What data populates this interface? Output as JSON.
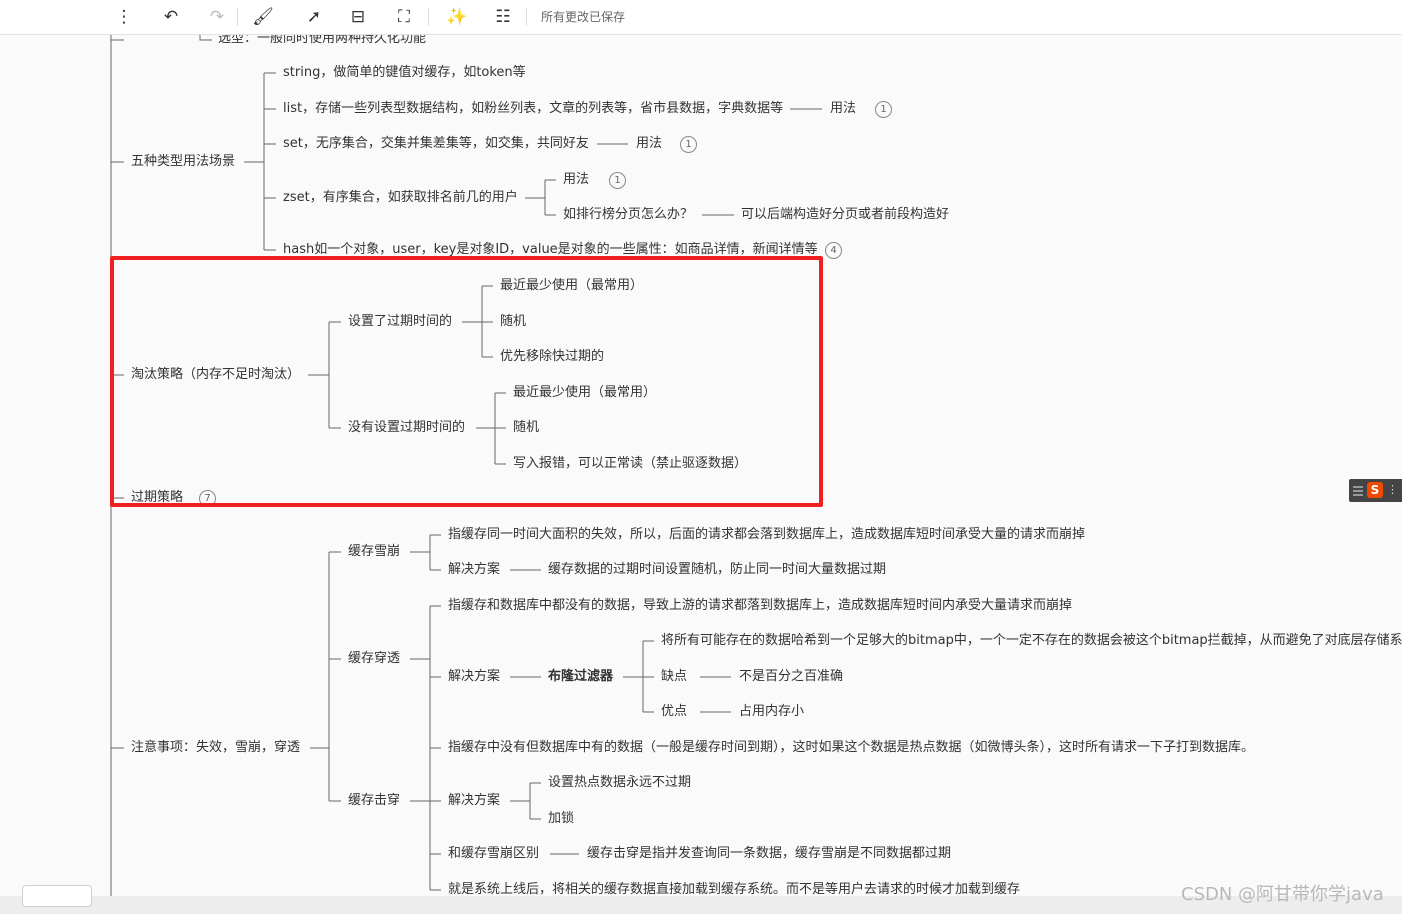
{
  "toolbar": {
    "save_status": "所有更改已保存",
    "buttons": [
      {
        "name": "more-options-icon",
        "glyph": "⋮"
      },
      {
        "name": "undo-icon",
        "glyph": "↶"
      },
      {
        "name": "redo-icon",
        "glyph": "↷"
      },
      {
        "name": "format-painter-icon",
        "glyph": "🖌"
      },
      {
        "name": "arrow-connect-icon",
        "glyph": "➚"
      },
      {
        "name": "insert-child-icon",
        "glyph": "⊟"
      },
      {
        "name": "frame-icon",
        "glyph": "⛶"
      },
      {
        "name": "magic-style-icon",
        "glyph": "✨"
      },
      {
        "name": "outline-structure-icon",
        "glyph": "☷"
      }
    ]
  },
  "nodes": {
    "top_partial": "选型：一般同时使用两种持久化功能",
    "five_types": "五种类型用法场景",
    "string": "string，做简单的键值对缓存，如token等",
    "list": "list，存储一些列表型数据结构，如粉丝列表，文章的列表等，省市县数据，字典数据等",
    "list_usage": "用法",
    "list_badge": "1",
    "set": "set，无序集合，交集并集差集等，如交集，共同好友",
    "set_usage": "用法",
    "set_badge": "1",
    "zset": "zset，有序集合，如获取排名前几的用户",
    "zset_usage": "用法",
    "zset_badge": "1",
    "zset_paging_q": "如排行榜分页怎么办？",
    "zset_paging_a": "可以后端构造好分页或者前段构造好",
    "hash": "hash如一个对象，user，key是对象ID，value是对象的一些属性：如商品详情，新闻详情等",
    "hash_badge": "4",
    "eviction": "淘汰策略（内存不足时淘汰）",
    "with_expire": "设置了过期时间的",
    "we_lru": "最近最少使用（最常用）",
    "we_random": "随机",
    "we_ttl": "优先移除快过期的",
    "no_expire": "没有设置过期时间的",
    "ne_lru": "最近最少使用（最常用）",
    "ne_random": "随机",
    "ne_error": "写入报错，可以正常读（禁止驱逐数据）",
    "expire_policy": "过期策略",
    "expire_badge": "7",
    "attention": "注意事项：失效，雪崩，穿透",
    "avalanche": "缓存雪崩",
    "av_desc": "指缓存同一时间大面积的失效，所以，后面的请求都会落到数据库上，造成数据库短时间承受大量的请求而崩掉",
    "av_solution": "解决方案",
    "av_solution_text": "缓存数据的过期时间设置随机，防止同一时间大量数据过期",
    "penetration": "缓存穿透",
    "pen_desc": "指缓存和数据库中都没有的数据，导致上游的请求都落到数据库上，造成数据库短时间内承受大量请求而崩掉",
    "pen_solution": "解决方案",
    "bloom": "布隆过滤器",
    "bloom_desc": "将所有可能存在的数据哈希到一个足够大的bitmap中，一个一定不存在的数据会被这个bitmap拦截掉，从而避免了对底层存储系统的查询压力",
    "bloom_cons": "缺点",
    "bloom_cons_text": "不是百分之百准确",
    "bloom_pros": "优点",
    "bloom_pros_text": "占用内存小",
    "breakdown": "缓存击穿",
    "bd_desc": "指缓存中没有但数据库中有的数据（一般是缓存时间到期），这时如果这个数据是热点数据（如微博头条），这时所有请求一下子打到数据库。",
    "bd_solution": "解决方案",
    "bd_sol_1": "设置热点数据永远不过期",
    "bd_sol_2": "加锁",
    "bd_vs": "和缓存雪崩区别",
    "bd_vs_text": "缓存击穿是指并发查询同一条数据，缓存雪崩是不同数据都过期",
    "warmup_partial": "就是系统上线后，将相关的缓存数据直接加载到缓存系统。而不是等用户去请求的时候才加载到缓存"
  },
  "watermark": "CSDN @阿甘带你学java",
  "colors": {
    "highlight": "#f02020",
    "line": "#666666"
  }
}
